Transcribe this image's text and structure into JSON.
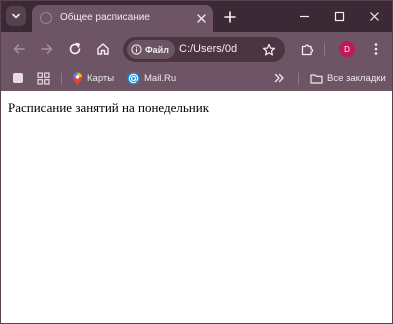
{
  "tab": {
    "title": "Общее расписание"
  },
  "toolbar": {
    "site_chip_label": "Файл",
    "url": "C:/Users/0d"
  },
  "bookmarks": {
    "items": [
      {
        "label": "Карты",
        "icon": "maps-pin-icon"
      },
      {
        "label": "Mail.Ru",
        "icon": "at-sign-icon"
      }
    ],
    "all_bookmarks_label": "Все закладки"
  },
  "profile": {
    "avatar_letter": "D",
    "avatar_color": "#c2185b"
  },
  "page": {
    "heading": "Расписание занятий на понедельник"
  },
  "colors": {
    "tabstrip": "#3b2a35",
    "toolbar": "#6e5565",
    "omnibox": "#4a3541",
    "page_bg": "#ffffff"
  }
}
